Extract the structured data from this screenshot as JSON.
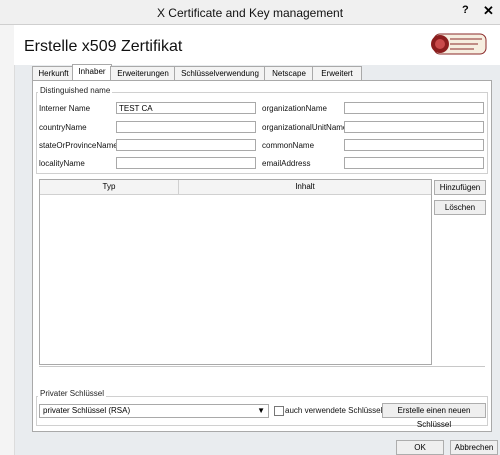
{
  "window": {
    "title": "X Certificate and Key management",
    "help": "?",
    "close": "✕"
  },
  "heading": "Erstelle x509 Zertifikat",
  "tabs": [
    {
      "label": "Herkunft"
    },
    {
      "label": "Inhaber"
    },
    {
      "label": "Erweiterungen"
    },
    {
      "label": "Schlüsselverwendung"
    },
    {
      "label": "Netscape"
    },
    {
      "label": "Erweitert"
    }
  ],
  "active_tab": "Inhaber",
  "distinguished_name": {
    "legend": "Distinguished name",
    "left": [
      {
        "label": "Interner Name",
        "value": "TEST CA"
      },
      {
        "label": "countryName",
        "value": ""
      },
      {
        "label": "stateOrProvinceName",
        "value": ""
      },
      {
        "label": "localityName",
        "value": ""
      }
    ],
    "right": [
      {
        "label": "organizationName",
        "value": ""
      },
      {
        "label": "organizationalUnitName",
        "value": ""
      },
      {
        "label": "commonName",
        "value": ""
      },
      {
        "label": "emailAddress",
        "value": ""
      }
    ]
  },
  "table": {
    "col_typ": "Typ",
    "col_inhalt": "Inhalt"
  },
  "buttons": {
    "add": "Hinzufügen",
    "delete": "Löschen",
    "ok": "OK",
    "cancel": "Abbrechen",
    "new_key": "Erstelle einen neuen Schlüssel"
  },
  "private_key": {
    "legend": "Privater Schlüssel",
    "selected": "privater Schlüssel (RSA)",
    "checkbox_label": "auch verwendete Schlüssel"
  }
}
